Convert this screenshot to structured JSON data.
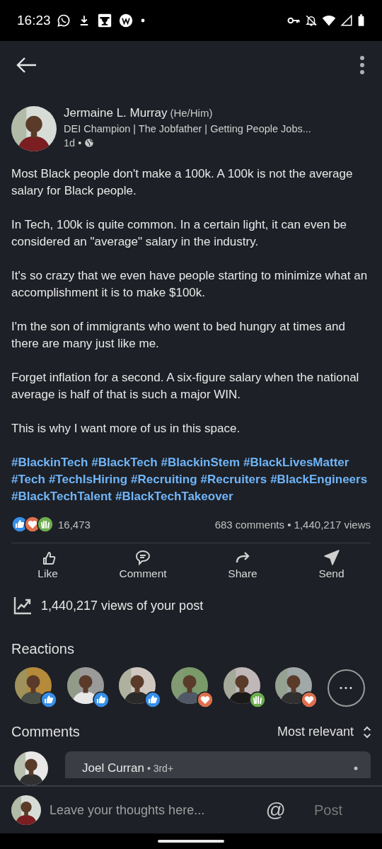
{
  "status_bar": {
    "time": "16:23"
  },
  "post": {
    "author": "Jermaine L. Murray",
    "pronouns": "(He/Him)",
    "headline": "DEI Champion | The Jobfather | Getting People Jobs...",
    "age": "1d •",
    "paragraphs": [
      "Most Black people don't make a 100k. A 100k is not the average salary for Black people.",
      "In Tech, 100k is quite common. In a certain light, it can even be considered an \"average\" salary in the industry.",
      "It's so crazy that we even have people starting to minimize what an accomplishment it is to make $100k.",
      "I'm the son of immigrants who went to bed hungry at times and there are many just like me.",
      "Forget inflation for a second. A six-figure salary when the national average is half of that is such a major WIN.",
      "This is why I want more of us in this space."
    ],
    "hashtags": [
      "#BlackinTech",
      "#BlackTech",
      "#BlackinStem",
      "#BlackLivesMatter",
      "#Tech",
      "#TechIsHiring",
      "#Recruiting",
      "#Recruiters",
      "#BlackEngineers",
      "#BlackTechTalent",
      "#BlackTechTakeover"
    ],
    "reaction_types": [
      {
        "kind": "like"
      },
      {
        "kind": "love"
      },
      {
        "kind": "celebrate"
      }
    ],
    "reaction_count": "16,473",
    "comments_views": "683 comments • 1,440,217 views"
  },
  "actions": [
    {
      "kind": "like",
      "label": "Like"
    },
    {
      "kind": "comment",
      "label": "Comment"
    },
    {
      "kind": "share",
      "label": "Share"
    },
    {
      "kind": "send",
      "label": "Send"
    }
  ],
  "views_line": "1,440,217 views of your post",
  "reactions": {
    "title": "Reactions",
    "people": [
      {
        "kind": "like"
      },
      {
        "kind": "like"
      },
      {
        "kind": "like"
      },
      {
        "kind": "love"
      },
      {
        "kind": "celebrate"
      },
      {
        "kind": "love"
      }
    ],
    "more": "•••"
  },
  "comments": {
    "title": "Comments",
    "sort": "Most relevant",
    "first": {
      "name": "Joel Curran",
      "degree": "• 3rd+"
    }
  },
  "composer": {
    "placeholder": "Leave your thoughts here...",
    "mention": "@",
    "post": "Post"
  }
}
